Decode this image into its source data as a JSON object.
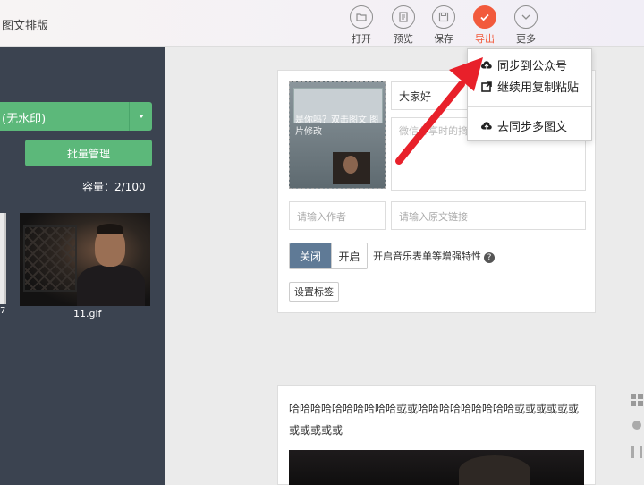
{
  "app": {
    "title": "图文排版"
  },
  "toolbar": {
    "open": "打开",
    "preview": "预览",
    "save": "保存",
    "export": "导出",
    "more": "更多"
  },
  "sidebar": {
    "watermark_select": "(无水印)",
    "batch_button": "批量管理",
    "capacity": "容量：2/100",
    "left_digit": "7",
    "thumb_caption": "11.gif"
  },
  "editor": {
    "cover_overlay": "是你吗？双击图文 图片修改",
    "title_value": "大家好",
    "digest_placeholder": "微信分享时的摘要",
    "author_placeholder": "请输入作者",
    "link_placeholder": "请输入原文链接",
    "toggle_off": "关闭",
    "toggle_on": "开启",
    "music_label": "开启音乐表单等增强特性",
    "help_glyph": "?",
    "tag_button": "设置标签"
  },
  "content": {
    "body_text": "哈哈哈哈哈哈哈哈哈哈或或哈哈哈哈哈哈哈哈哈或或或或或或或或或或或"
  },
  "export_menu": {
    "items": [
      {
        "label": "同步到公众号",
        "icon": "cloud-upload-icon"
      },
      {
        "label": "继续用复制粘贴",
        "icon": "external-link-icon"
      },
      {
        "label": "去同步多图文",
        "icon": "cloud-upload-icon"
      }
    ]
  },
  "colors": {
    "accent": "#f25a3c",
    "sidebar_bg": "#3b4350",
    "green": "#5cb87a",
    "arrow": "#e8202a",
    "toggle_active": "#5f7a96"
  }
}
